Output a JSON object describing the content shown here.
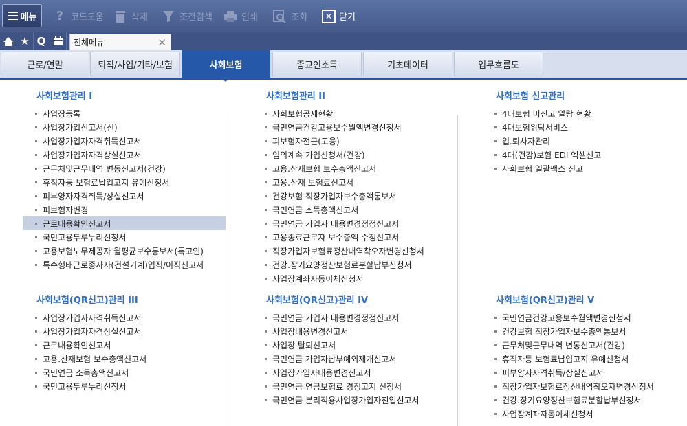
{
  "toolbar": {
    "menu": "메뉴",
    "code_help": "코드도움",
    "delete": "삭제",
    "filter": "조건검색",
    "print": "인쇄",
    "view": "조회",
    "close": "닫기"
  },
  "tab": {
    "label": "전체메뉴"
  },
  "categories": [
    "근로/연말",
    "퇴직/사업/기타/보험",
    "사회보험",
    "종교인소득",
    "기초데이터",
    "업무흐름도"
  ],
  "sections": [
    {
      "title": "사회보험관리 I",
      "items": [
        "사업장등록",
        "사업장가입신고서(신)",
        "사업장가입자자격취득신고서",
        "사업장가입자자격상실신고서",
        "근무처및근무내역 변동신고서(건강)",
        "휴직자등 보험료납입고지 유예신청서",
        "피부양자자격취득/상실신고서",
        "피보험자변경",
        "근로내용확인신고서",
        "국민고용두루누리신청서",
        "고용보험노무제공자 월평균보수통보서(특고인)",
        "특수형태근로종사자(건설기계)입직/이직신고서"
      ]
    },
    {
      "title": "사회보험관리 II",
      "items": [
        "사회보험공제현황",
        "국민연금건강고용보수월액변경신청서",
        "피보험자전근(고용)",
        "임의계속 가입신청서(건강)",
        "고용.산재보험 보수총액신고서",
        "고용.산재 보험료신고서",
        "건강보험 직장가입자보수총액통보서",
        "국민연금 소득총액신고서",
        "국민연금 가입자 내용변경정정신고서",
        "고용종료근로자 보수총액 수정신고서",
        "직장가입자보험료정산내역착오자변경신청서",
        "건강.장기요양정산보험료분할납부신청서",
        "사업장계좌자동이체신청서"
      ]
    },
    {
      "title": "사회보험 신고관리",
      "items": [
        "4대보험 미신고 알람 현황",
        "4대보험위탁서비스",
        "입.퇴사자관리",
        "4대(건강)보험 EDI 엑셀신고",
        "사회보험 일괄팩스 신고"
      ]
    },
    {
      "title": "사회보험(QR신고)관리 III",
      "items": [
        "사업장가입자자격취득신고서",
        "사업장가입자자격상실신고서",
        "근로내용확인신고서",
        "고용.산재보험 보수총액신고서",
        "국민연금 소득총액신고서",
        "국민고용두루누리신청서"
      ]
    },
    {
      "title": "사회보험(QR신고)관리 IV",
      "items": [
        "국민연금 가입자 내용변경정정신고서",
        "사업장내용변경신고서",
        "사업장 탈퇴신고서",
        "국민연금 가입자납부예외재개신고서",
        "사업장가입자내용변경신고서",
        "국민연금 연금보험료 경정고지 신청서",
        "국민연금 분리적용사업장가입자전입신고서"
      ]
    },
    {
      "title": "사회보험(QR신고)관리 V",
      "items": [
        "국민연금건강고용보수월액변경신청서",
        "건강보험 직장가입자보수총액통보서",
        "근무처및근무내역 변동신고서(건강)",
        "휴직자등 보험료납입고지 유예신청서",
        "피부양자자격취득/상실신고서",
        "직장가입자보험료정산내역착오자변경신청서",
        "건강.장기요양정산보험료분할납부신청서",
        "사업장계좌자동이체신청서"
      ]
    }
  ],
  "selected_item": "근로내용확인신고서"
}
